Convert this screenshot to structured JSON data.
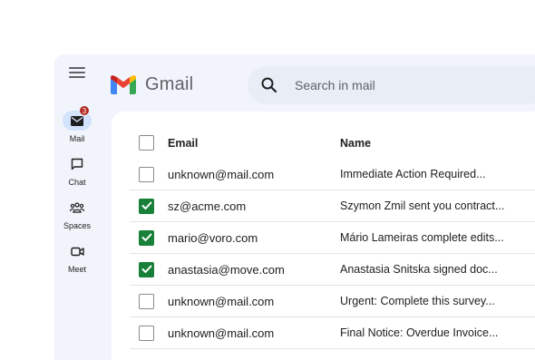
{
  "app": {
    "name": "Gmail"
  },
  "colors": {
    "accent_checked": "#188038",
    "badge": "#b3261e",
    "rail_active": "#d3e3fd",
    "window_bg": "#f1f4fb"
  },
  "rail": {
    "menu_icon": "hamburger-icon",
    "items": [
      {
        "label": "Mail",
        "icon": "mail-icon",
        "badge": "3",
        "active": true
      },
      {
        "label": "Chat",
        "icon": "chat-icon"
      },
      {
        "label": "Spaces",
        "icon": "spaces-icon"
      },
      {
        "label": "Meet",
        "icon": "video-icon"
      }
    ]
  },
  "search": {
    "placeholder": "Search in mail",
    "icon": "search-icon"
  },
  "table": {
    "headers": {
      "email": "Email",
      "name": "Name"
    },
    "rows": [
      {
        "email": "unknown@mail.com",
        "name": "Immediate Action Required...",
        "checked": false
      },
      {
        "email": "sz@acme.com",
        "name": "Szymon Zmil sent you contract...",
        "checked": true
      },
      {
        "email": "mario@voro.com",
        "name": "Mário Lameiras complete edits...",
        "checked": true
      },
      {
        "email": "anastasia@move.com",
        "name": "Anastasia Snitska signed doc...",
        "checked": true
      },
      {
        "email": "unknown@mail.com",
        "name": "Urgent: Complete this survey...",
        "checked": false
      },
      {
        "email": "unknown@mail.com",
        "name": "Final Notice: Overdue Invoice...",
        "checked": false
      }
    ]
  }
}
